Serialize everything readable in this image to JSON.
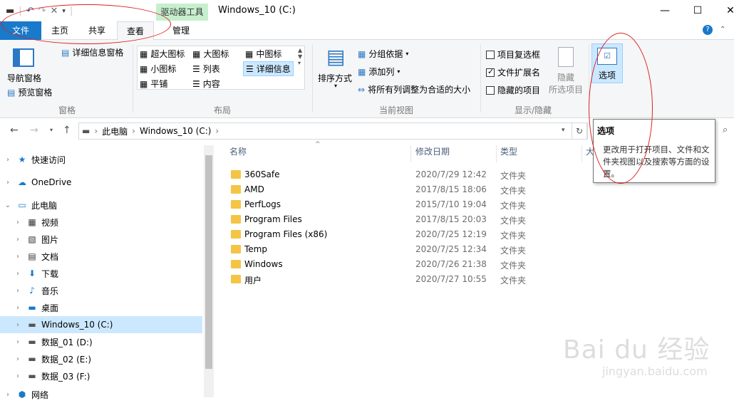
{
  "window": {
    "title": "Windows_10 (C:)",
    "context_group": "驱动器工具"
  },
  "tabs": {
    "file": "文件",
    "home": "主页",
    "share": "共享",
    "view": "查看",
    "manage": "管理"
  },
  "ribbon": {
    "panes": {
      "label": "窗格",
      "nav_pane": "导航窗格",
      "preview_pane": "预览窗格",
      "details_pane": "详细信息窗格"
    },
    "layout": {
      "label": "布局",
      "items": [
        "超大图标",
        "大图标",
        "中图标",
        "小图标",
        "列表",
        "详细信息",
        "平铺",
        "内容"
      ]
    },
    "current_view": {
      "label": "当前视图",
      "sort": "排序方式",
      "group_by": "分组依据",
      "add_columns": "添加列",
      "fit_columns": "将所有列调整为合适的大小"
    },
    "show_hide": {
      "label": "显示/隐藏",
      "item_checkboxes": "项目复选框",
      "file_extensions": "文件扩展名",
      "hidden_items": "隐藏的项目",
      "hide_selected": "隐藏",
      "hide_selected2": "所选项目"
    },
    "options": {
      "label": "选项"
    }
  },
  "address": {
    "crumbs": [
      "此电脑",
      "Windows_10 (C:)"
    ]
  },
  "tooltip": {
    "title": "选项",
    "desc": "更改用于打开项目、文件和文件夹视图以及搜索等方面的设置。"
  },
  "nav": [
    {
      "label": "快速访问",
      "icon": "star-icon"
    },
    {
      "label": "OneDrive",
      "icon": "cloud-icon"
    },
    {
      "label": "此电脑",
      "icon": "computer-icon"
    },
    {
      "label": "视频",
      "icon": "video-icon"
    },
    {
      "label": "图片",
      "icon": "picture-icon"
    },
    {
      "label": "文档",
      "icon": "document-icon"
    },
    {
      "label": "下载",
      "icon": "download-icon"
    },
    {
      "label": "音乐",
      "icon": "music-icon"
    },
    {
      "label": "桌面",
      "icon": "desktop-icon"
    },
    {
      "label": "Windows_10 (C:)",
      "icon": "drive-icon"
    },
    {
      "label": "数据_01 (D:)",
      "icon": "drive-icon"
    },
    {
      "label": "数据_02 (E:)",
      "icon": "drive-icon"
    },
    {
      "label": "数据_03 (F:)",
      "icon": "drive-icon"
    },
    {
      "label": "网络",
      "icon": "network-icon"
    }
  ],
  "columns": {
    "name": "名称",
    "date": "修改日期",
    "type": "类型",
    "size": "大"
  },
  "files": [
    {
      "name": "360Safe",
      "date": "2020/7/29 12:42",
      "type": "文件夹"
    },
    {
      "name": "AMD",
      "date": "2017/8/15 18:06",
      "type": "文件夹"
    },
    {
      "name": "PerfLogs",
      "date": "2015/7/10 19:04",
      "type": "文件夹"
    },
    {
      "name": "Program Files",
      "date": "2017/8/15 20:03",
      "type": "文件夹"
    },
    {
      "name": "Program Files (x86)",
      "date": "2020/7/25 12:19",
      "type": "文件夹"
    },
    {
      "name": "Temp",
      "date": "2020/7/25 12:34",
      "type": "文件夹"
    },
    {
      "name": "Windows",
      "date": "2020/7/26 21:38",
      "type": "文件夹"
    },
    {
      "name": "用户",
      "date": "2020/7/27 10:55",
      "type": "文件夹"
    }
  ],
  "watermark": {
    "brand": "Bai du 经验",
    "url": "jingyan.baidu.com"
  }
}
